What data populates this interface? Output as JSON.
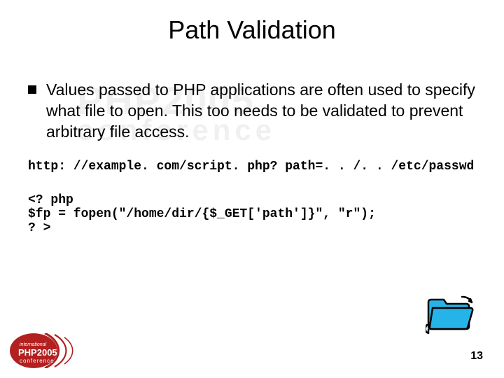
{
  "title": "Path Validation",
  "bullet": "Values passed to PHP applications are often used to specify what file to open. This too needs to be validated to prevent arbitrary file access.",
  "url_line": "http: //example. com/script. php? path=. . /. . /etc/passwd",
  "code": {
    "l1": "<? php",
    "l2": "$fp = fopen(\"/home/dir/{$_GET['path']}\", \"r\");",
    "l3": "? >"
  },
  "watermark": {
    "line1": "PHP2005",
    "line2": "conference"
  },
  "logo": {
    "top": "international",
    "mid": "PHP2005",
    "bot": "conference"
  },
  "page_number": "13"
}
